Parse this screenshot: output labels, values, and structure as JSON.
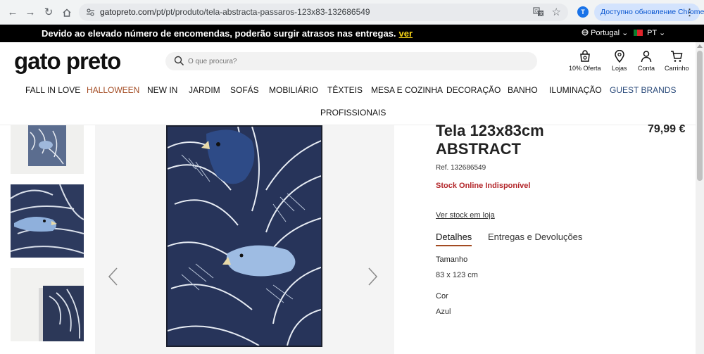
{
  "browser": {
    "url_host": "gatopreto.com",
    "url_path": "/pt/pt/produto/tela-abstracta-passaros-123x83-132686549",
    "profile_initial": "T",
    "update_label": "Доступно обновление Chrome"
  },
  "announcement": {
    "message": "Devido ao elevado número de encomendas, poderão surgir atrasos nas entregas.",
    "link": "ver",
    "language": "Portugal",
    "country": "PT"
  },
  "header": {
    "logo": "gato preto",
    "search_placeholder": "O que procura?",
    "icons": [
      {
        "label": "10% Oferta",
        "icon": "gift-bag-icon"
      },
      {
        "label": "Lojas",
        "icon": "location-pin-icon"
      },
      {
        "label": "Conta",
        "icon": "user-icon"
      },
      {
        "label": "Carrinho",
        "icon": "cart-icon"
      }
    ]
  },
  "categories": [
    "FALL IN LOVE",
    "HALLOWEEN",
    "NEW IN",
    "JARDIM",
    "SOFÁS",
    "MOBILIÁRIO",
    "TÊXTEIS",
    "MESA E COZINHA",
    "DECORAÇÃO",
    "BANHO",
    "ILUMINAÇÃO",
    "GUEST BRANDS",
    "PROFISSIONAIS"
  ],
  "product": {
    "title_line1": "Tela 123x83cm",
    "title_line2": "ABSTRACT",
    "price": "79,99 €",
    "ref": "Ref. 132686549",
    "stock_status": "Stock Online Indisponível",
    "stock_link": "Ver stock em loja",
    "tabs": [
      "Detalhes",
      "Entregas e Devoluções"
    ],
    "details": [
      {
        "label": "Tamanho",
        "value": "83 x 123 cm"
      },
      {
        "label": "Cor",
        "value": "Azul"
      }
    ]
  },
  "colors": {
    "accent": "#a34b22",
    "stock_unavailable": "#b3262a",
    "announcement_link": "#f7d417",
    "guest_brands": "#2a4a7a"
  }
}
